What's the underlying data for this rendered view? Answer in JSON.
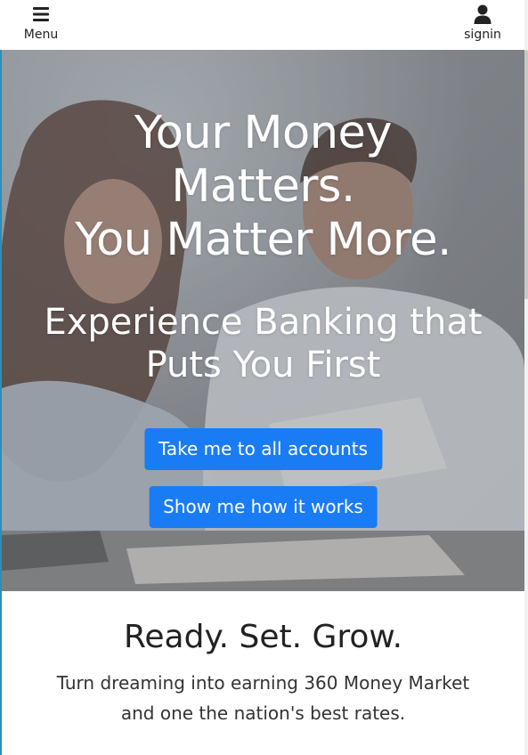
{
  "header": {
    "menu_label": "Menu",
    "menu_icon": "hamburger-icon",
    "signin_label": "signin",
    "signin_icon": "user-icon"
  },
  "hero": {
    "title_line1": "Your Money",
    "title_line2": "Matters.",
    "title_line3": "You Matter More.",
    "subtitle_line1": "Experience Banking that",
    "subtitle_line2": "Puts You First",
    "cta_primary": "Take me to all accounts",
    "cta_secondary": "Show me how it works"
  },
  "grow": {
    "title": "Ready. Set. Grow.",
    "text": "Turn dreaming into earning 360 Money Market and one the nation's best rates."
  },
  "colors": {
    "button": "#1a7cf5",
    "hero_overlay": "#6f6f6f",
    "accent_edge": "#2a8fb8"
  }
}
